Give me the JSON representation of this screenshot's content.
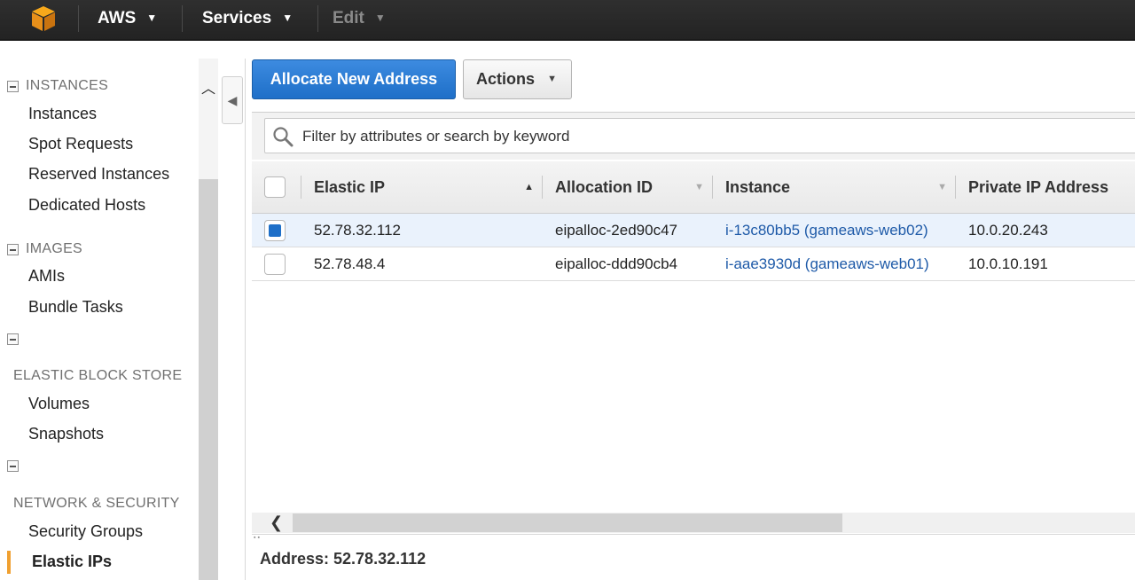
{
  "topnav": {
    "brand": "AWS",
    "services": "Services",
    "edit": "Edit",
    "caret": "▼"
  },
  "sidebar": {
    "sections": [
      {
        "title": "INSTANCES",
        "items": [
          "Instances",
          "Spot Requests",
          "Reserved Instances",
          "Dedicated Hosts"
        ]
      },
      {
        "title": "IMAGES",
        "items": [
          "AMIs",
          "Bundle Tasks"
        ]
      },
      {
        "title": "ELASTIC BLOCK STORE",
        "items": [
          "Volumes",
          "Snapshots"
        ]
      },
      {
        "title": "NETWORK & SECURITY",
        "items": [
          "Security Groups",
          "Elastic IPs"
        ]
      }
    ],
    "active_item": "Elastic IPs"
  },
  "toolbar": {
    "allocate_label": "Allocate New Address",
    "actions_label": "Actions"
  },
  "search": {
    "placeholder": "Filter by attributes or search by keyword"
  },
  "table": {
    "columns": [
      "Elastic IP",
      "Allocation ID",
      "Instance",
      "Private IP Address"
    ],
    "rows": [
      {
        "selected": true,
        "elastic_ip": "52.78.32.112",
        "allocation_id": "eipalloc-2ed90c47",
        "instance": "i-13c80bb5 (gameaws-web02)",
        "private_ip": "10.0.20.243"
      },
      {
        "selected": false,
        "elastic_ip": "52.78.48.4",
        "allocation_id": "eipalloc-ddd90cb4",
        "instance": "i-aae3930d (gameaws-web01)",
        "private_ip": "10.0.10.191"
      }
    ]
  },
  "detail": {
    "title": "Address: 52.78.32.112"
  },
  "colors": {
    "primary": "#1e6fc8",
    "link": "#1e5aa8",
    "active_marker": "#f0a030",
    "topbar": "#232323"
  }
}
